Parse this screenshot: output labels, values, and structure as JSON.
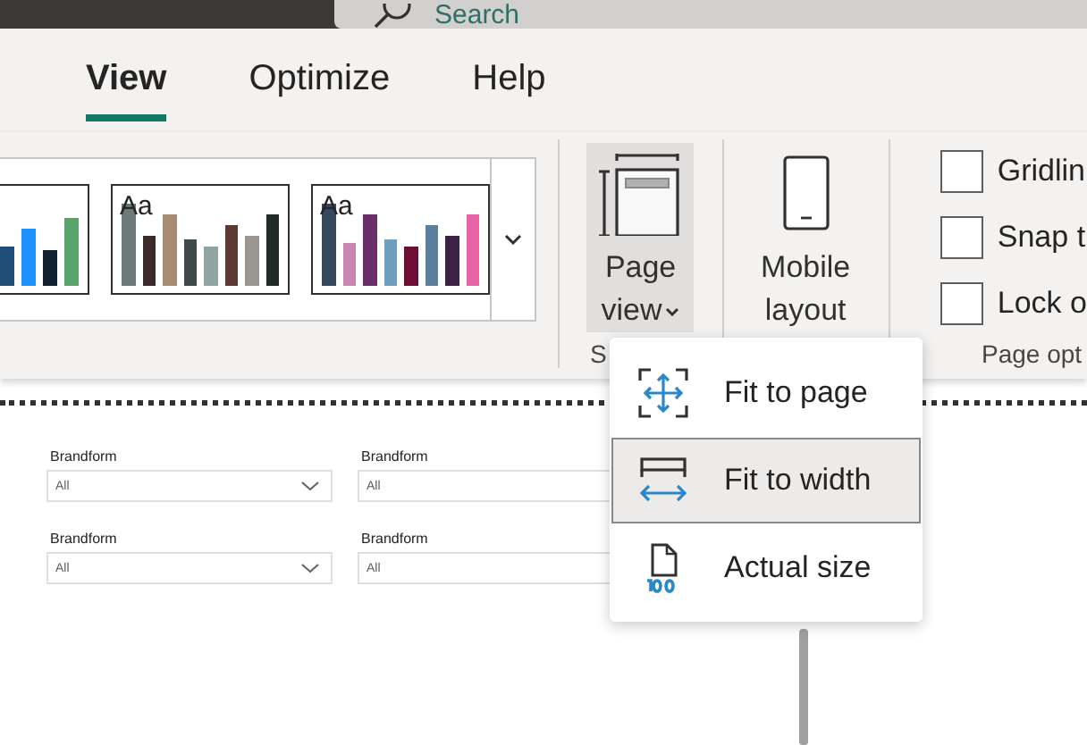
{
  "search": {
    "placeholder": "Search"
  },
  "tabs": [
    {
      "label": "View",
      "selected": true
    },
    {
      "label": "Optimize",
      "selected": false
    },
    {
      "label": "Help",
      "selected": false
    }
  ],
  "ribbon": {
    "themes": [
      {
        "cut": true
      },
      {
        "cut": false,
        "sample": "Aa"
      },
      {
        "cut": false,
        "sample": "Aa"
      }
    ],
    "buttons": [
      {
        "kind": "page-view",
        "label": "Page view",
        "pressed": true
      },
      {
        "kind": "mobile",
        "label": "Mobile layout",
        "pressed": false
      }
    ],
    "checkboxes": [
      {
        "label": "Gridlin",
        "checked": false
      },
      {
        "label": "Snap t",
        "checked": false
      },
      {
        "label": "Lock o",
        "checked": false
      }
    ],
    "group_labels": [
      "S",
      "Page opt"
    ]
  },
  "canvas": {
    "slicers": [
      {
        "title": "Brandform",
        "value": "All",
        "kind": "dropdown"
      },
      {
        "title": "Brandform",
        "value": "All",
        "kind": "covered"
      },
      {
        "title": "Brandform",
        "value": "All",
        "kind": "dropdown"
      },
      {
        "title": "Brandform",
        "value": "All",
        "kind": "covered"
      }
    ]
  },
  "menu": {
    "items": [
      {
        "kind": "fit-page",
        "label": "Fit to page",
        "selected": false
      },
      {
        "kind": "fit-width",
        "label": "Fit to width",
        "selected": true
      },
      {
        "kind": "actual",
        "label": "Actual size",
        "selected": false
      }
    ]
  }
}
